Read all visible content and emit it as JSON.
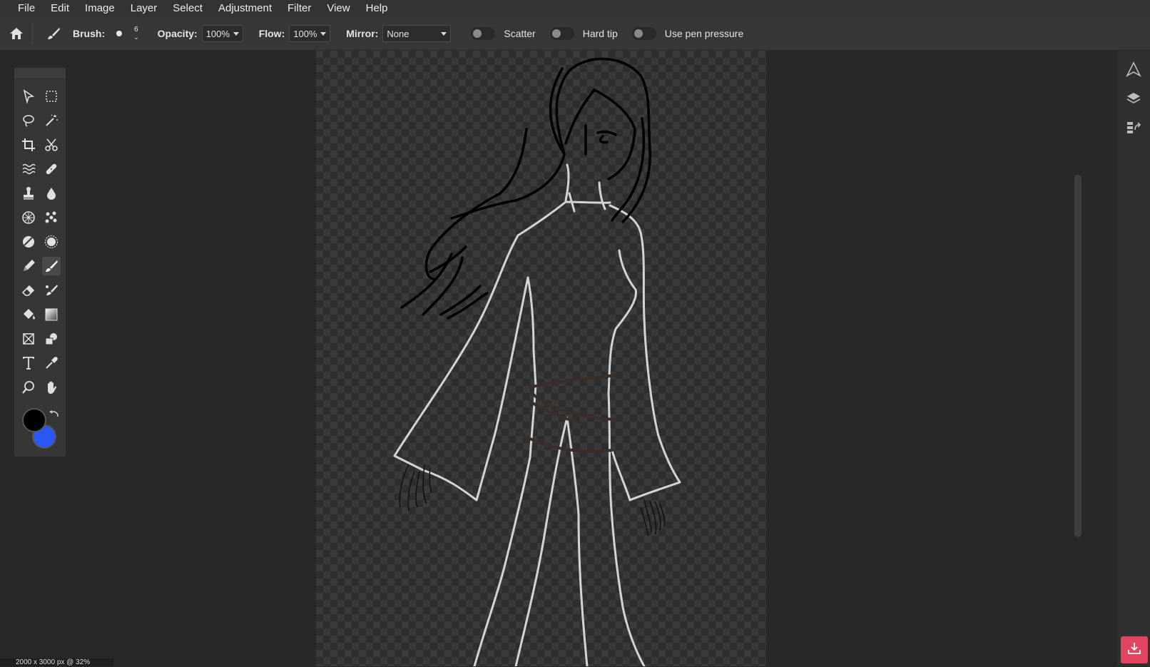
{
  "menu": [
    "File",
    "Edit",
    "Image",
    "Layer",
    "Select",
    "Adjustment",
    "Filter",
    "View",
    "Help"
  ],
  "options": {
    "brush_label": "Brush:",
    "brush_size": "6",
    "opacity_label": "Opacity:",
    "opacity_value": "100%",
    "flow_label": "Flow:",
    "flow_value": "100%",
    "mirror_label": "Mirror:",
    "mirror_value": "None",
    "scatter_label": "Scatter",
    "hardtip_label": "Hard tip",
    "pen_pressure_label": "Use pen pressure"
  },
  "colors": {
    "foreground": "#000000",
    "background": "#2b57f5",
    "accent": "#e2455f"
  },
  "status": {
    "info": "2000 x 3000 px @ 32%"
  },
  "tools": [
    "select-arrow-icon",
    "marquee-icon",
    "lasso-icon",
    "magic-wand-icon",
    "crop-icon",
    "scissors-icon",
    "liquify-icon",
    "heal-icon",
    "stamp-icon",
    "blur-drop-icon",
    "sponge-icon",
    "pattern-icon",
    "dodge-icon",
    "burn-icon",
    "pencil-icon",
    "brush-icon",
    "eraser-icon",
    "color-replace-icon",
    "bucket-icon",
    "gradient-icon",
    "transform-icon",
    "shape-icon",
    "text-icon",
    "eyedropper-icon",
    "zoom-icon",
    "hand-icon"
  ]
}
